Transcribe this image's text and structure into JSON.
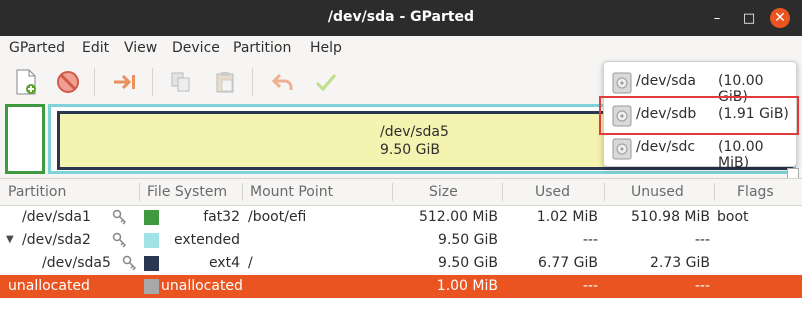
{
  "window": {
    "title": "/dev/sda - GParted",
    "minimize": "–",
    "maximize": "□",
    "close": "✕"
  },
  "menu": [
    "GParted",
    "Edit",
    "View",
    "Device",
    "Partition",
    "Help"
  ],
  "toolbar": {
    "icons": [
      "new-partition-icon",
      "delete-icon",
      "resize-move-icon",
      "copy-icon",
      "paste-icon",
      "undo-icon",
      "apply-icon"
    ]
  },
  "diskmap": {
    "partition_name": "/dev/sda5",
    "partition_size": "9.50 GiB"
  },
  "devices": [
    {
      "name": "/dev/sda",
      "size": "(10.00 GiB)"
    },
    {
      "name": "/dev/sdb",
      "size": "(1.91 GiB)"
    },
    {
      "name": "/dev/sdc",
      "size": "(10.00 MiB)"
    }
  ],
  "columns": {
    "partition": "Partition",
    "filesystem": "File System",
    "mount": "Mount Point",
    "size": "Size",
    "used": "Used",
    "unused": "Unused",
    "flags": "Flags"
  },
  "rows": [
    {
      "partition": "/dev/sda1",
      "fs": "fat32",
      "fs_color": "#3f9a3f",
      "mount": "/boot/efi",
      "size": "512.00 MiB",
      "used": "1.02 MiB",
      "unused": "510.98 MiB",
      "flags": "boot",
      "key": true
    },
    {
      "partition": "/dev/sda2",
      "fs": "extended",
      "fs_color": "#9fe3e6",
      "mount": "",
      "size": "9.50 GiB",
      "used": "---",
      "unused": "---",
      "flags": "",
      "key": true,
      "expanded": true
    },
    {
      "partition": "/dev/sda5",
      "fs": "ext4",
      "fs_color": "#2b3650",
      "mount": "/",
      "size": "9.50 GiB",
      "used": "6.77 GiB",
      "unused": "2.73 GiB",
      "flags": "",
      "key": true
    },
    {
      "partition": "unallocated",
      "fs": "unallocated",
      "fs_color": "#a8a8a8",
      "mount": "",
      "size": "1.00 MiB",
      "used": "---",
      "unused": "---",
      "flags": "",
      "key": false,
      "selected": true
    }
  ]
}
